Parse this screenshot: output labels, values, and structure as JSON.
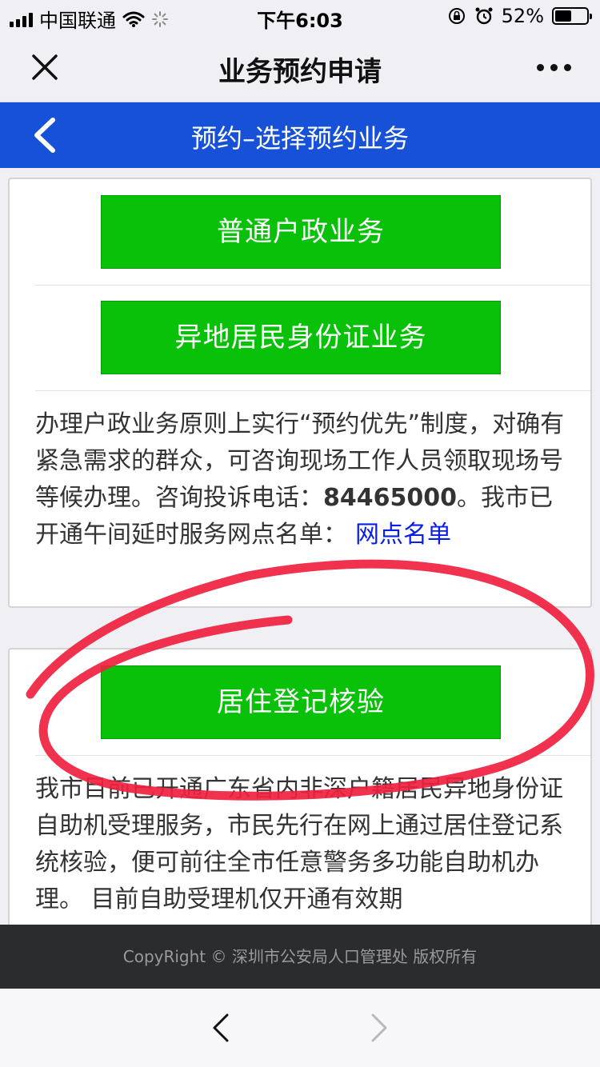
{
  "status_bar": {
    "carrier": "中国联通",
    "time": "下午6:03",
    "battery_percent_text": "52%",
    "battery_level": 0.52
  },
  "nav": {
    "title": "业务预约申请",
    "close_icon": "close-icon",
    "more_icon": "more-dots-icon"
  },
  "header": {
    "title": "预约–选择预约业务",
    "back_icon": "chevron-left-icon",
    "color": "#1651d8"
  },
  "card1": {
    "buttons": [
      "普通户政业务",
      "异地居民身份证业务"
    ],
    "notice": "办理户政业务原则上实行“预约优先”制度，对确有紧急需求的群众，可咨询现场工作人员领取现场号等候办理。咨询投诉电话：",
    "phone": "84465000",
    "notice2": "。我市已开通午间延时服务网点名单：",
    "link": "网点名单"
  },
  "card2": {
    "button": "居住登记核验",
    "notice": "我市目前已开通广东省内非深户籍居民异地身份证自助机受理服务，市民先行在网上通过居住登记系统核验，便可前往全市任意警务多功能自助机办理。 目前自助受理机仅开通有效期"
  },
  "footer": {
    "text": "CopyRight © 深圳市公安局人口管理处 版权所有"
  },
  "toolbar": {
    "back_icon": "chevron-left-icon",
    "forward_icon": "chevron-right-icon"
  },
  "colors": {
    "button_green": "#0ac10a",
    "link_blue": "#0a1ee6",
    "annotation_red": "#f0213f"
  }
}
